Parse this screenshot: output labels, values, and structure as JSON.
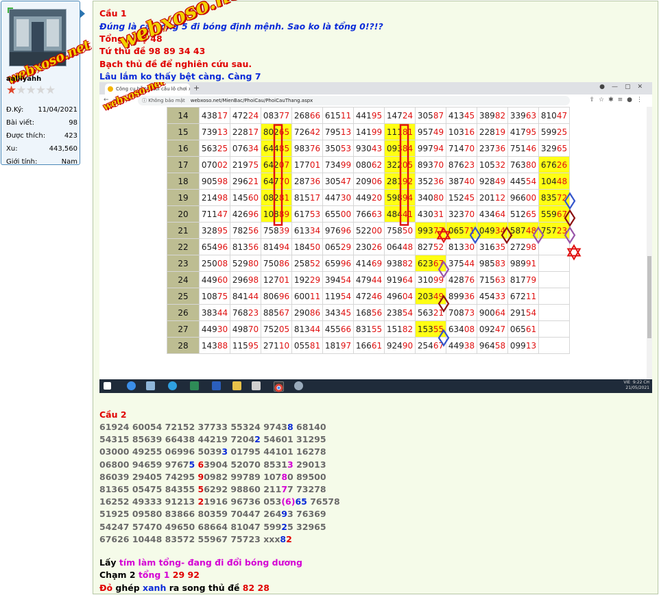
{
  "user": {
    "name": "aalliyahh",
    "stats": [
      {
        "label": "Đ.Ký:",
        "value": "11/04/2021"
      },
      {
        "label": "Bài viết:",
        "value": "98"
      },
      {
        "label": "Được thích:",
        "value": "423"
      },
      {
        "label": "Xu:",
        "value": "443,560"
      },
      {
        "label": "Giới tính:",
        "value": "Nam"
      }
    ],
    "rating_stars": 5,
    "rating_filled": 1
  },
  "watermark": "webxoso.net",
  "post": {
    "cau1_title": "Cầu 1",
    "l1": "Đúng là cái tổng 5 đi bóng định mệnh. Sao ko là tổng 0!?!?",
    "l2": "Tổng 7 bộ 48",
    "l3": "Tứ thủ đề 98 89 34 43",
    "l4": "Bạch thủ đề để nghiên cứu sau.",
    "l5": "Lâu lắm ko thấy bệt càng. Càng 7",
    "cau2_title": "Cầu 2",
    "cau2_lines": [
      [
        {
          "t": "61924 60054 72152 37733 55324 9743",
          "c": "gray"
        },
        {
          "t": "8",
          "c": "blue"
        },
        {
          "t": " 68140",
          "c": "gray"
        }
      ],
      [
        {
          "t": "54315 85639 66438 44219 7204",
          "c": "gray"
        },
        {
          "t": "2",
          "c": "blue"
        },
        {
          "t": " 54601 31295",
          "c": "gray"
        }
      ],
      [
        {
          "t": "03000 49255 06996 5039",
          "c": "gray"
        },
        {
          "t": "3",
          "c": "blue"
        },
        {
          "t": " 01795 44101 16278",
          "c": "gray"
        }
      ],
      [
        {
          "t": "06800 94659 9767",
          "c": "gray"
        },
        {
          "t": "5",
          "c": "blue"
        },
        {
          "t": " ",
          "c": "gray"
        },
        {
          "t": "6",
          "c": "red"
        },
        {
          "t": "3904 52070 8531",
          "c": "gray"
        },
        {
          "t": "3",
          "c": "mag"
        },
        {
          "t": " 29013",
          "c": "gray"
        }
      ],
      [
        {
          "t": "86039 29405 74295 ",
          "c": "gray"
        },
        {
          "t": "9",
          "c": "red"
        },
        {
          "t": "0982 99789 107",
          "c": "gray"
        },
        {
          "t": "8",
          "c": "mag"
        },
        {
          "t": "0 89500",
          "c": "gray"
        }
      ],
      [
        {
          "t": "81365 05475 84355 ",
          "c": "gray"
        },
        {
          "t": "5",
          "c": "red"
        },
        {
          "t": "6292 98860 211",
          "c": "gray"
        },
        {
          "t": "7",
          "c": "mag"
        },
        {
          "t": "7 73278",
          "c": "gray"
        }
      ],
      [
        {
          "t": "16252 49333 91213 ",
          "c": "gray"
        },
        {
          "t": "2",
          "c": "red"
        },
        {
          "t": "1916 96736 053",
          "c": "gray"
        },
        {
          "t": "(6)",
          "c": "mag"
        },
        {
          "t": "65",
          "c": "blue"
        },
        {
          "t": " 76578",
          "c": "gray"
        }
      ],
      [
        {
          "t": "51925 09580 83866 80359 70447 264",
          "c": "gray"
        },
        {
          "t": "9",
          "c": "blue"
        },
        {
          "t": "3 76369",
          "c": "gray"
        }
      ],
      [
        {
          "t": "54247 57470 49650 68664 81047 599",
          "c": "gray"
        },
        {
          "t": "2",
          "c": "blue"
        },
        {
          "t": "5 32965",
          "c": "gray"
        }
      ],
      [
        {
          "t": "67626 10448 83572 55967 75723 xxx",
          "c": "gray"
        },
        {
          "t": "8",
          "c": "blue"
        },
        {
          "t": "2",
          "c": "red"
        }
      ]
    ],
    "f1": [
      {
        "t": "Lấy ",
        "c": "blk"
      },
      {
        "t": "tím làm tổng- đang đi đổi bóng dương",
        "c": "mag"
      }
    ],
    "f2": [
      {
        "t": "Chạm 2 ",
        "c": "blk"
      },
      {
        "t": "tổng 1 ",
        "c": "mag"
      },
      {
        "t": "29 92",
        "c": "red"
      }
    ],
    "f3": [
      {
        "t": "Đỏ",
        "c": "red"
      },
      {
        "t": " ghép ",
        "c": "blk"
      },
      {
        "t": "xanh",
        "c": "blue"
      },
      {
        "t": " ra song thủ đề ",
        "c": "blk"
      },
      {
        "t": "82 28",
        "c": "red"
      }
    ]
  },
  "screenshot": {
    "tab_title": "Công cụ hỗ trợ soi cầu lô chơi x",
    "new_tab": "+",
    "address_warning": "Không bảo mật",
    "url": "webxoso.net/MienBac/PhoiCau/PhoiCauThang.aspx",
    "taskbar_time": "9:22 CH",
    "taskbar_date": "21/05/2021",
    "taskbar_lang": "VIE",
    "rows": [
      {
        "n": "14",
        "cells": [
          "43817",
          "47224",
          "08377",
          "26866",
          "61511",
          "44195",
          "14724",
          "30587",
          "41345",
          "38982",
          "33963",
          "81047"
        ]
      },
      {
        "n": "15",
        "cells": [
          "73913",
          "22817",
          "80265",
          "72642",
          "79513",
          "14199",
          "11181",
          "95749",
          "10316",
          "22819",
          "41795",
          "59925"
        ]
      },
      {
        "n": "16",
        "cells": [
          "56325",
          "07634",
          "64485",
          "98376",
          "35053",
          "93043",
          "09384",
          "99794",
          "71470",
          "23736",
          "75146",
          "32965"
        ]
      },
      {
        "n": "17",
        "cells": [
          "07002",
          "21975",
          "64207",
          "17701",
          "73499",
          "08062",
          "32205",
          "89370",
          "87623",
          "10532",
          "76380",
          "67626"
        ]
      },
      {
        "n": "18",
        "cells": [
          "90598",
          "29621",
          "64770",
          "28736",
          "30547",
          "20906",
          "28192",
          "35236",
          "38740",
          "92849",
          "44554",
          "10448"
        ]
      },
      {
        "n": "19",
        "cells": [
          "21498",
          "14560",
          "08281",
          "81517",
          "44730",
          "44920",
          "59894",
          "34080",
          "15245",
          "20112",
          "96600",
          "83572"
        ]
      },
      {
        "n": "20",
        "cells": [
          "71147",
          "42696",
          "10889",
          "61753",
          "65500",
          "76663",
          "48441",
          "43031",
          "32370",
          "43464",
          "51265",
          "55967"
        ]
      },
      {
        "n": "21",
        "cells": [
          "32895",
          "78256",
          "75839",
          "61334",
          "97696",
          "52200",
          "75850",
          "99377",
          "06571",
          "04934",
          "58748",
          "75723"
        ]
      },
      {
        "n": "22",
        "cells": [
          "65496",
          "81356",
          "81494",
          "18450",
          "06529",
          "23026",
          "06448",
          "82752",
          "81330",
          "31635",
          "27298",
          ""
        ]
      },
      {
        "n": "23",
        "cells": [
          "25008",
          "52980",
          "75086",
          "25852",
          "65996",
          "41469",
          "93882",
          "62367",
          "37544",
          "98583",
          "98991",
          ""
        ]
      },
      {
        "n": "24",
        "cells": [
          "44960",
          "29698",
          "12701",
          "19229",
          "39454",
          "47944",
          "91964",
          "31099",
          "42876",
          "71563",
          "81779",
          ""
        ]
      },
      {
        "n": "25",
        "cells": [
          "10875",
          "84144",
          "80696",
          "60011",
          "11954",
          "47246",
          "49604",
          "20349",
          "89936",
          "45433",
          "67211",
          ""
        ]
      },
      {
        "n": "26",
        "cells": [
          "38344",
          "76823",
          "88567",
          "29086",
          "34345",
          "16856",
          "23854",
          "56321",
          "70873",
          "90064",
          "29154",
          ""
        ]
      },
      {
        "n": "27",
        "cells": [
          "44930",
          "49870",
          "75205",
          "81344",
          "45566",
          "83155",
          "15182",
          "15355",
          "63408",
          "09247",
          "06561",
          ""
        ]
      },
      {
        "n": "28",
        "cells": [
          "14388",
          "11595",
          "27110",
          "05581",
          "18197",
          "16661",
          "92490",
          "25467",
          "44938",
          "96458",
          "09913",
          ""
        ]
      }
    ],
    "highlights": [
      [
        15,
        2
      ],
      [
        16,
        2
      ],
      [
        17,
        2
      ],
      [
        18,
        2
      ],
      [
        19,
        2
      ],
      [
        20,
        2
      ],
      [
        15,
        6
      ],
      [
        16,
        6
      ],
      [
        17,
        6
      ],
      [
        18,
        6
      ],
      [
        19,
        6
      ],
      [
        20,
        6
      ],
      [
        17,
        11
      ],
      [
        18,
        11
      ],
      [
        19,
        11
      ],
      [
        20,
        11
      ],
      [
        21,
        11
      ],
      [
        21,
        7
      ],
      [
        21,
        8
      ],
      [
        21,
        9
      ],
      [
        21,
        10
      ],
      [
        23,
        7
      ],
      [
        25,
        7
      ],
      [
        27,
        7
      ]
    ]
  }
}
